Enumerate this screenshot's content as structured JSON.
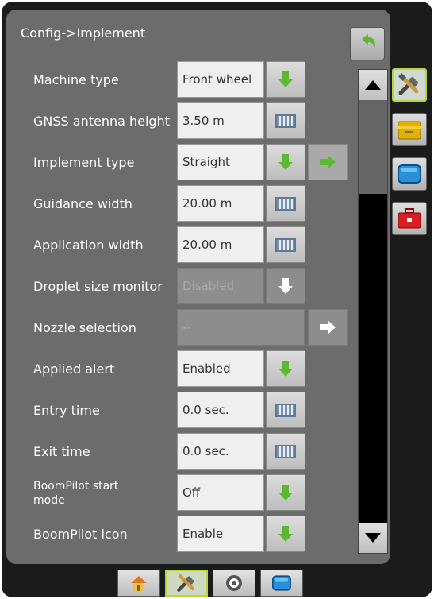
{
  "title": "Config->Implement",
  "icons": {
    "back": "return-arrow-icon",
    "down_arrow": "green-down-arrow-icon",
    "right_arrow": "green-right-arrow-icon",
    "keyboard": "keyboard-icon",
    "tools": "tools-icon",
    "folder": "yellow-folder-icon",
    "screen": "blue-screen-icon",
    "toolbox": "red-toolbox-icon",
    "home": "home-icon",
    "target": "target-icon"
  },
  "colors": {
    "accent": "#b7d43a",
    "arrow_green": "#5cb82e",
    "panel": "#6c6c6c"
  },
  "rows": [
    {
      "label": "Machine type",
      "value": "Front wheel"
    },
    {
      "label": "GNSS antenna height",
      "value": "3.50 m"
    },
    {
      "label": "Implement type",
      "value": "Straight"
    },
    {
      "label": "Guidance width",
      "value": "20.00 m"
    },
    {
      "label": "Application width",
      "value": "20.00 m"
    },
    {
      "label": "Droplet size monitor",
      "value": "Disabled"
    },
    {
      "label": "Nozzle selection",
      "value": "--"
    },
    {
      "label": "Applied alert",
      "value": "Enabled"
    },
    {
      "label": "Entry time",
      "value": "0.0 sec."
    },
    {
      "label": "Exit time",
      "value": "0.0 sec."
    },
    {
      "label": "BoomPilot start mode",
      "value": "Off"
    },
    {
      "label": "BoomPilot icon",
      "value": "Enable"
    }
  ]
}
